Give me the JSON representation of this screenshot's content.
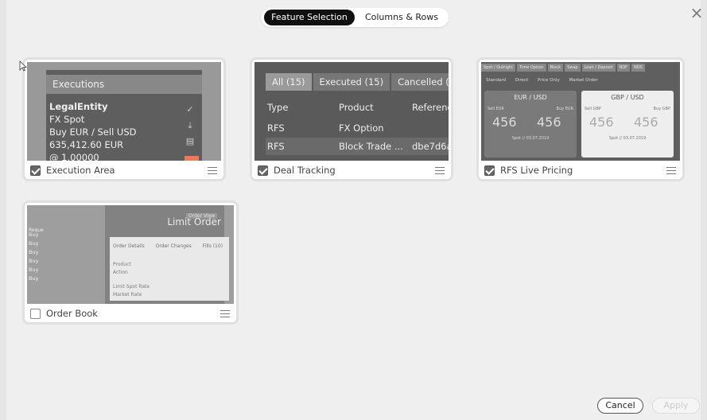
{
  "header": {
    "tabs": [
      {
        "label": "Feature Selection",
        "active": true
      },
      {
        "label": "Columns & Rows",
        "active": false
      }
    ],
    "close_icon": "×"
  },
  "cards": [
    {
      "label": "Execution Area",
      "checked": true,
      "preview": {
        "title": "Executions",
        "lines": [
          "LegalEntity",
          "FX Spot",
          "Buy EUR / Sell USD",
          "635,412.60 EUR",
          "@ 1.00000"
        ]
      }
    },
    {
      "label": "Deal Tracking",
      "checked": true,
      "preview": {
        "tabs": [
          "All (15)",
          "Executed (15)",
          "Cancelled (0)"
        ],
        "columns": [
          "Type",
          "Product",
          "Reference"
        ],
        "rows": [
          [
            "RFS",
            "FX Option",
            ""
          ],
          [
            "RFS",
            "Block Trade ...",
            "dbe7d6af"
          ]
        ]
      }
    },
    {
      "label": "RFS Live Pricing",
      "checked": true,
      "preview": {
        "tabs": [
          "Spot / Outright",
          "Time Option",
          "Block",
          "Swap",
          "Loan / Deposit",
          "NDF",
          "NDS"
        ],
        "subtabs": [
          "Standard",
          "Direct",
          "Price Only",
          "Market Order"
        ],
        "pairs": [
          {
            "pair": "EUR / USD",
            "sell": "Sell EUR",
            "buy": "Buy EUR",
            "price": "456",
            "date": "Spot // 03.07.2019"
          },
          {
            "pair": "GBP / USD",
            "sell": "Sell GBP",
            "buy": "Buy GBP",
            "price": "456",
            "date": "Spot // 03.07.2019"
          }
        ]
      }
    },
    {
      "label": "Order Book",
      "checked": false,
      "preview": {
        "title": "Limit Order",
        "badge": "Order View",
        "tabs": [
          "Order Details",
          "Order Changes",
          "Fills (10)"
        ],
        "fields": [
          "Product",
          "Action",
          "Limit Spot Rate",
          "Market Rate"
        ],
        "row_label": "Buy",
        "column_label": "Reque"
      }
    }
  ],
  "footer": {
    "cancel": "Cancel",
    "apply": "Apply"
  }
}
